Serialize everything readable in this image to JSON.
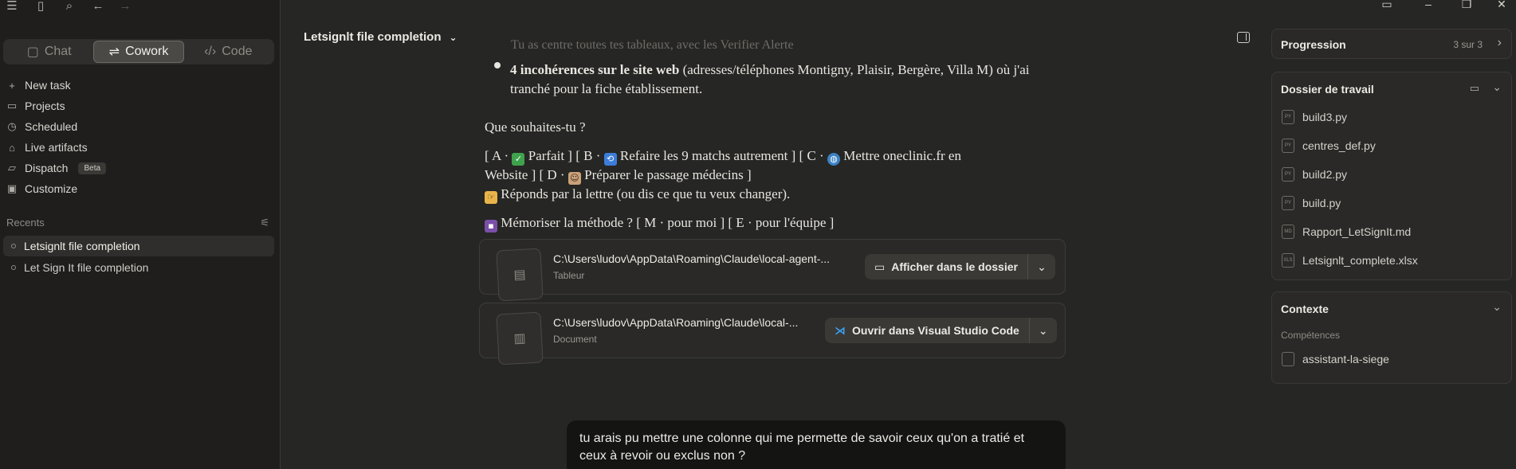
{
  "sidebar": {
    "modes": [
      {
        "label": "Chat",
        "icon": "chat-bubble-icon"
      },
      {
        "label": "Cowork",
        "icon": "cowork-icon"
      },
      {
        "label": "Code",
        "icon": "code-brackets-icon"
      }
    ],
    "nav": [
      {
        "label": "New task",
        "icon": "plus-icon"
      },
      {
        "label": "Projects",
        "icon": "folder-icon"
      },
      {
        "label": "Scheduled",
        "icon": "clock-icon"
      },
      {
        "label": "Live artifacts",
        "icon": "grid-icon"
      },
      {
        "label": "Dispatch",
        "icon": "dispatch-icon",
        "badge": "Beta"
      },
      {
        "label": "Customize",
        "icon": "briefcase-icon"
      }
    ],
    "recents_label": "Recents",
    "recents": [
      "Letsignlt file completion",
      "Let Sign It file completion"
    ]
  },
  "main": {
    "title": "Letsignlt file completion",
    "faded_line": "Tu as centre toutes tes tableaux, avec les Verifier Alerte",
    "bullet_bold": "4 incohérences sur le site web",
    "bullet_rest": " (adresses/téléphones Montigny, Plaisir, Bergère, Villa M) où j'ai tranché pour la fiche établissement.",
    "question": "Que souhaites-tu ?",
    "options_line1_a": "[ A · ",
    "options_line1_b": " Parfait ]   [ B · ",
    "options_line1_c": " Refaire les 9 matchs autrement ]   [ C · ",
    "options_line1_d": " Mettre oneclinic.fr en",
    "options_line2_a": "Website ]   [ D · ",
    "options_line2_b": " Préparer le passage médecins ]",
    "options_line3": " Réponds par la lettre (ou dis ce que tu veux changer).",
    "memorize": " Mémoriser la méthode ? [ M · pour moi ] [ E · pour l'équipe ]",
    "files": [
      {
        "path": "C:\\Users\\ludov\\AppData\\Roaming\\Claude\\local-agent-...",
        "type": "Tableur",
        "action": "Afficher dans le dossier"
      },
      {
        "path": "C:\\Users\\ludov\\AppData\\Roaming\\Claude\\local-...",
        "type": "Document",
        "action": "Ouvrir dans Visual Studio Code"
      }
    ],
    "user_message": "tu arais pu mettre une colonne qui me permette de savoir ceux qu'on a tratié et ceux à revoir ou exclus non ?"
  },
  "right_panel": {
    "progress_label": "Progression",
    "progress_count": "3 sur 3",
    "folder_label": "Dossier de travail",
    "files": [
      {
        "name": "build3.py",
        "ext": "PY"
      },
      {
        "name": "centres_def.py",
        "ext": "PY"
      },
      {
        "name": "build2.py",
        "ext": "PY"
      },
      {
        "name": "build.py",
        "ext": "PY"
      },
      {
        "name": "Rapport_LetSignIt.md",
        "ext": "MD"
      },
      {
        "name": "Letsignlt_complete.xlsx",
        "ext": "XLS"
      }
    ],
    "context_label": "Contexte",
    "skills_label": "Compétences",
    "skill": "assistant-la-siege"
  }
}
